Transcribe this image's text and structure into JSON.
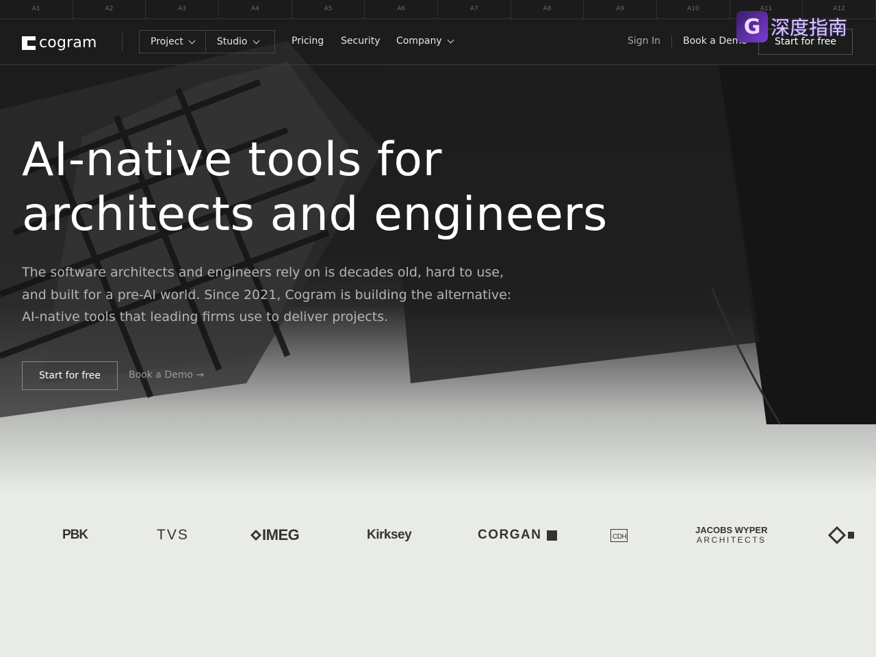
{
  "ruler": [
    "A1",
    "A2",
    "A3",
    "A4",
    "A5",
    "A6",
    "A7",
    "A8",
    "A9",
    "A10",
    "A11",
    "A12"
  ],
  "brand": {
    "name": "cogram"
  },
  "nav": {
    "project": "Project",
    "studio": "Studio",
    "pricing": "Pricing",
    "security": "Security",
    "company": "Company",
    "sign_in": "Sign In",
    "book_demo": "Book a Demo",
    "start_free": "Start for free"
  },
  "watermark": {
    "text": "深度指南"
  },
  "hero": {
    "headline_line1": "AI-native tools for",
    "headline_line2": "architects and engineers",
    "subtitle_line1": "The software architects and engineers rely on is decades old, hard to use,",
    "subtitle_line2": "and built for a pre-AI world. Since 2021, Cogram is building the alternative:",
    "subtitle_line3": "AI-native tools that leading firms use to deliver projects.",
    "cta_primary": "Start for free",
    "cta_secondary": "Book a Demo →"
  },
  "clients": [
    "PBK",
    "TVS",
    "IMEG",
    "Kirksey",
    "CORGAN",
    "CDH",
    "JACOBS WYPER",
    "ARCHITECTS"
  ],
  "colors": {
    "hero_dark": "#1b1b1b",
    "page_light": "#e9ebe7",
    "accent_text": "#ffffff"
  }
}
